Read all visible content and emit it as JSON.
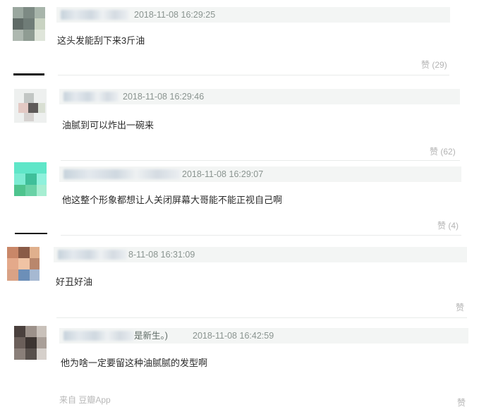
{
  "comments": [
    {
      "name_suffix": "",
      "time": "2018-11-08 16:29:25",
      "text": "这头发能刮下来3斤油",
      "vote_label": "赞",
      "vote_count": "(29)"
    },
    {
      "name_suffix": "",
      "time": "2018-11-08 16:29:46",
      "text": "油腻到可以炸出一碗来",
      "vote_label": "赞",
      "vote_count": "(62)"
    },
    {
      "name_suffix": "",
      "time": "2018-11-08 16:29:07",
      "text": "他这整个形象都想让人关闭屏幕大哥能不能正视自己啊",
      "vote_label": "赞",
      "vote_count": "(4)"
    },
    {
      "name_suffix": "",
      "time": "8-11-08 16:31:09",
      "text": "好丑好油",
      "vote_label": "赞",
      "vote_count": ""
    },
    {
      "name_suffix": "是新生。)",
      "time": "2018-11-08 16:42:59",
      "text": "他为啥一定要留这种油腻腻的发型啊",
      "vote_label": "赞",
      "vote_count": "",
      "source": "来自 豆瓣App"
    }
  ],
  "colors": {
    "header_bg": "#f3f5f4",
    "text": "#2b2b2b",
    "muted": "#b3b3b3"
  }
}
